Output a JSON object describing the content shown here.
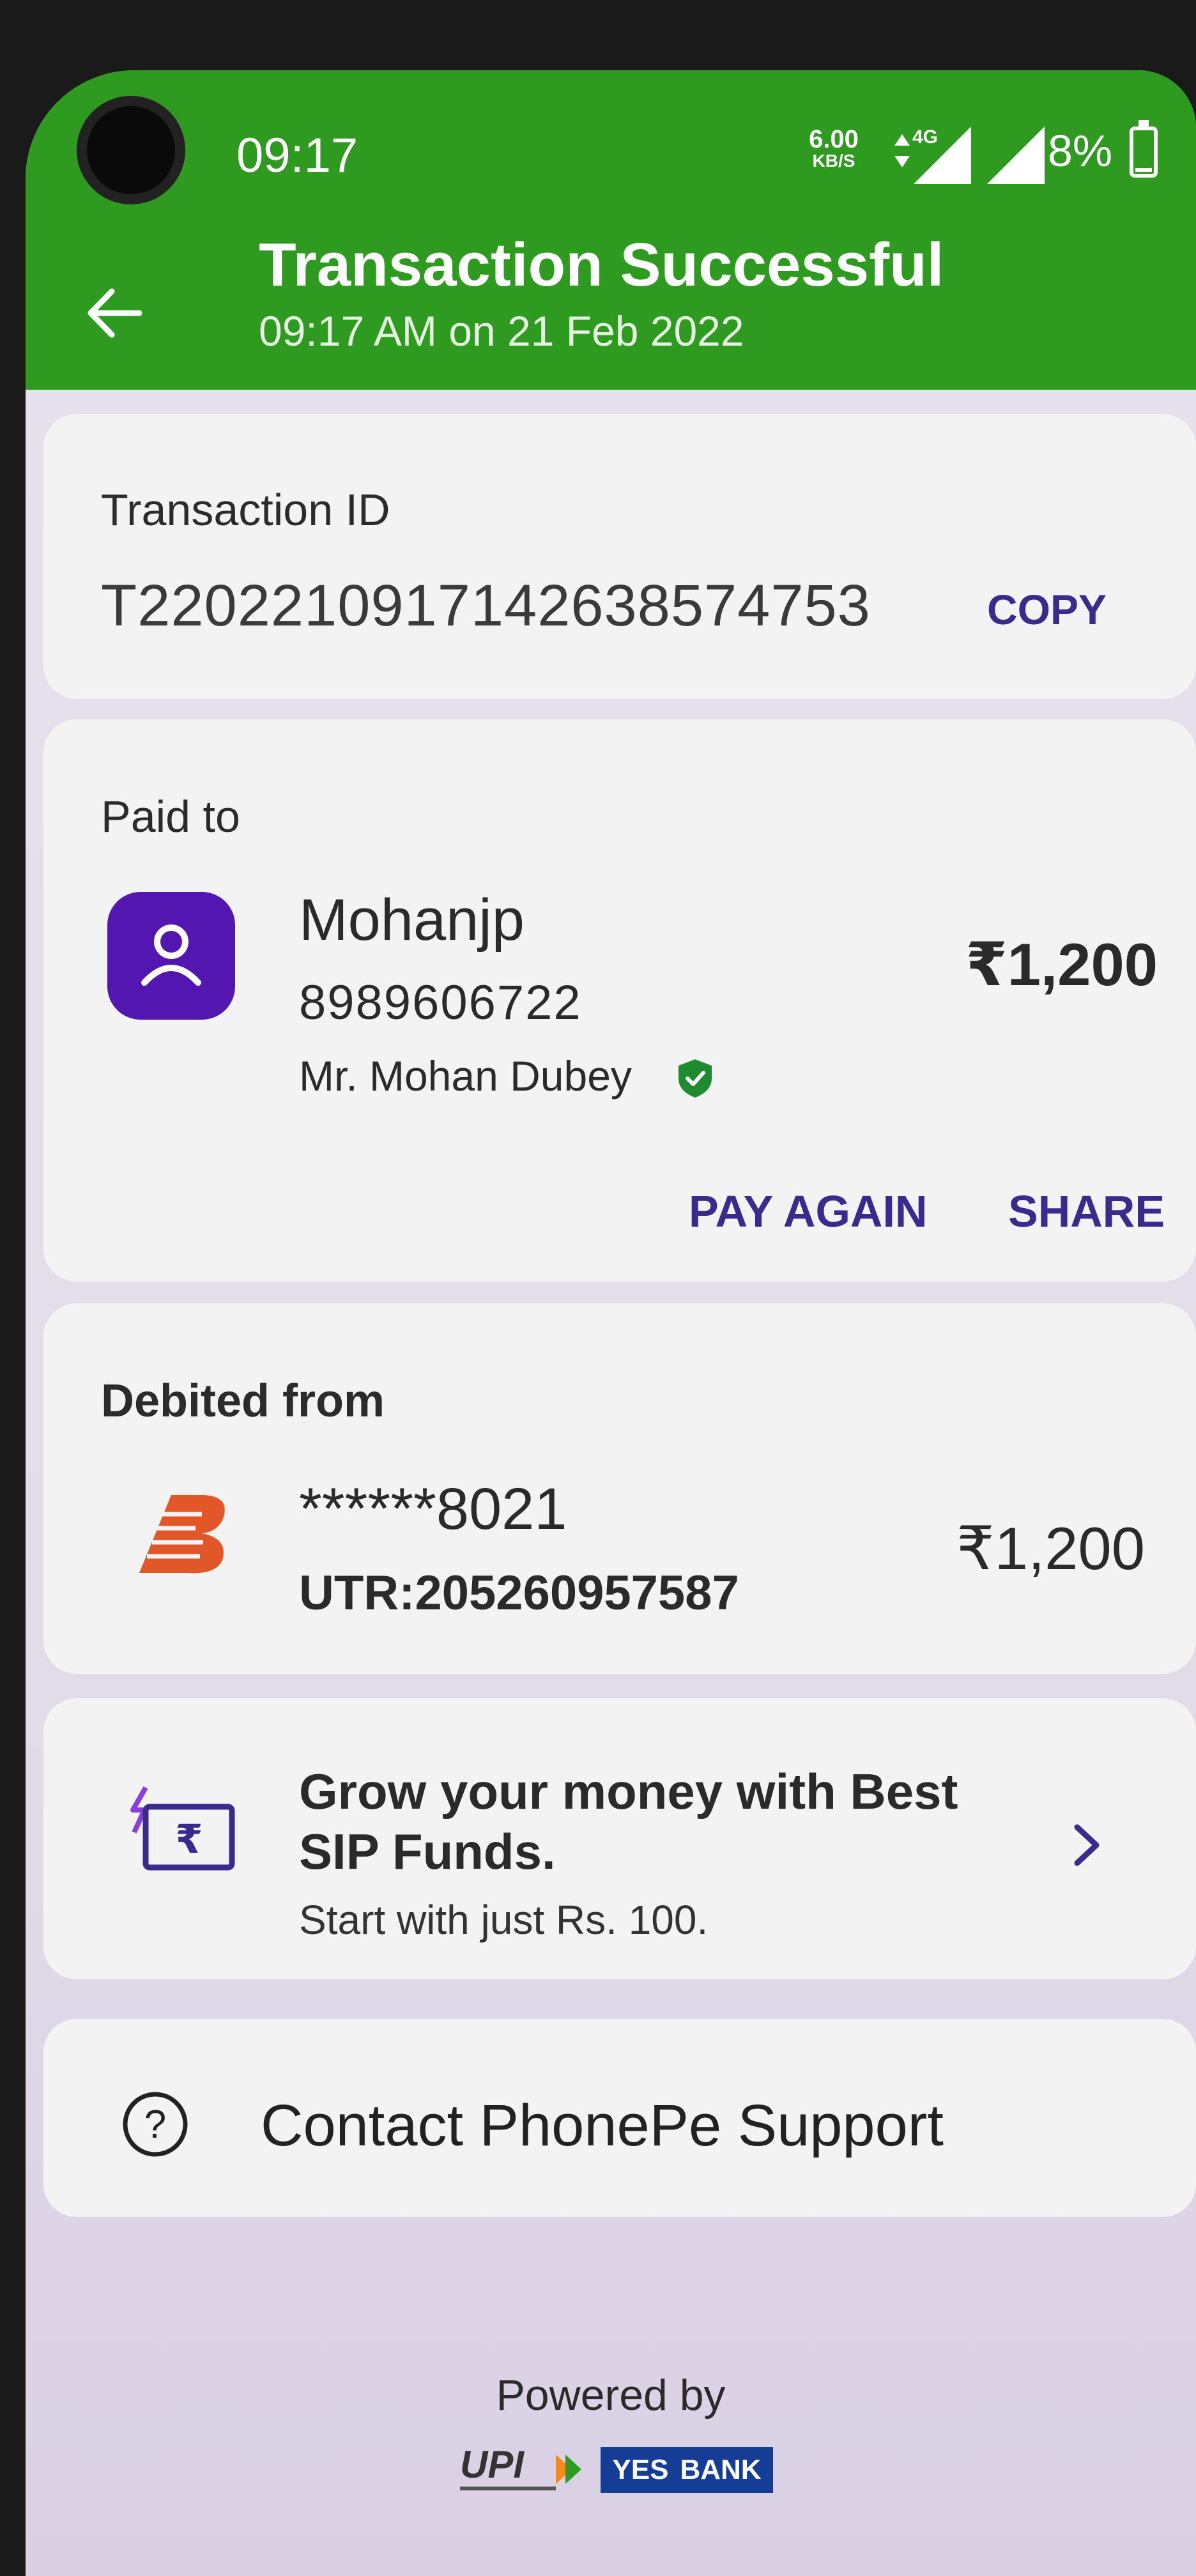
{
  "status_bar": {
    "time": "09:17",
    "net_speed_value": "6.00",
    "net_speed_unit": "KB/S",
    "network_type": "4G",
    "battery": "8%"
  },
  "header": {
    "title": "Transaction Successful",
    "subtitle": "09:17 AM on 21 Feb 2022",
    "color": "#2e9a1f"
  },
  "transaction": {
    "label": "Transaction ID",
    "id": "T2202210917142638574753",
    "copy_label": "COPY"
  },
  "paid_to": {
    "label": "Paid to",
    "name": "Mohanjp",
    "phone": "8989606722",
    "full_name": "Mr. Mohan  Dubey",
    "amount": "₹1,200",
    "pay_again_label": "PAY AGAIN",
    "share_label": "SHARE",
    "avatar_color": "#5416b0"
  },
  "debited_from": {
    "label": "Debited from",
    "account": "******8021",
    "utr": "UTR:205260957587",
    "amount": "₹1,200"
  },
  "promo": {
    "headline": "Grow your money with Best SIP Funds.",
    "subtext": "Start with just Rs. 100."
  },
  "support": {
    "label": "Contact PhonePe Support"
  },
  "footer": {
    "powered_by": "Powered by",
    "upi_text": "UPI",
    "bank_text_1": "YES",
    "bank_text_2": "BANK"
  },
  "theme": {
    "link_color": "#3b2a8e",
    "verified_color": "#1f8a2f",
    "bank_logo_color": "#e2572a"
  }
}
